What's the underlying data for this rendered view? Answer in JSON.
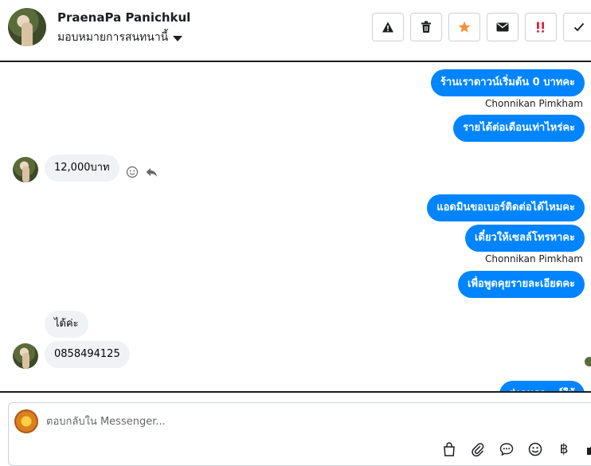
{
  "header": {
    "contact_name": "PraenaPa Panichkul",
    "assign_label": "มอบหมายการสนทนานี้",
    "actions": [
      {
        "name": "warning-icon",
        "color": "#1c1e21"
      },
      {
        "name": "trash-icon",
        "color": "#1c1e21"
      },
      {
        "name": "star-icon",
        "color": "#f7923a"
      },
      {
        "name": "envelope-icon",
        "color": "#1c1e21"
      },
      {
        "name": "spam-icon",
        "color": "#e41e3f"
      },
      {
        "name": "check-icon",
        "color": "#1c1e21"
      }
    ]
  },
  "thread": {
    "messages": [
      {
        "direction": "outgoing",
        "text": "ร้านเราดาวน์เริ่มต้น 0 บาทคะ"
      },
      {
        "direction": "sender-label",
        "text": "Chonnikan Pimkham"
      },
      {
        "direction": "outgoing",
        "text": "รายได้ต่อเดือนเท่าไหร่คะ"
      },
      {
        "direction": "incoming",
        "text": "12,000บาท"
      },
      {
        "direction": "outgoing",
        "text": "แอดมินขอเบอร์ติดต่อได้ไหมคะ"
      },
      {
        "direction": "outgoing",
        "text": "เดี๋ยวให้เซลล์โทรหาคะ"
      },
      {
        "direction": "sender-label",
        "text": "Chonnikan Pimkham"
      },
      {
        "direction": "outgoing",
        "text": "เพื่อพูดคุยรายละเอียดคะ"
      },
      {
        "direction": "incoming",
        "text": "ได้ค่ะ"
      },
      {
        "direction": "incoming",
        "text": "0858494125"
      },
      {
        "direction": "outgoing",
        "text": "ส่งคนรถ...ร์ให้"
      }
    ]
  },
  "composer": {
    "placeholder": "ตอบกลับใน Messenger...",
    "tools": [
      "bag-icon",
      "paperclip-icon",
      "chat-bubble-icon",
      "emoji-icon",
      "baht-icon",
      "like-icon"
    ],
    "baht_symbol": "฿"
  },
  "colors": {
    "outgoing_bubble": "#0084ff",
    "incoming_bubble": "#f0f2f5",
    "accent_star": "#f7923a",
    "accent_spam": "#e41e3f"
  }
}
